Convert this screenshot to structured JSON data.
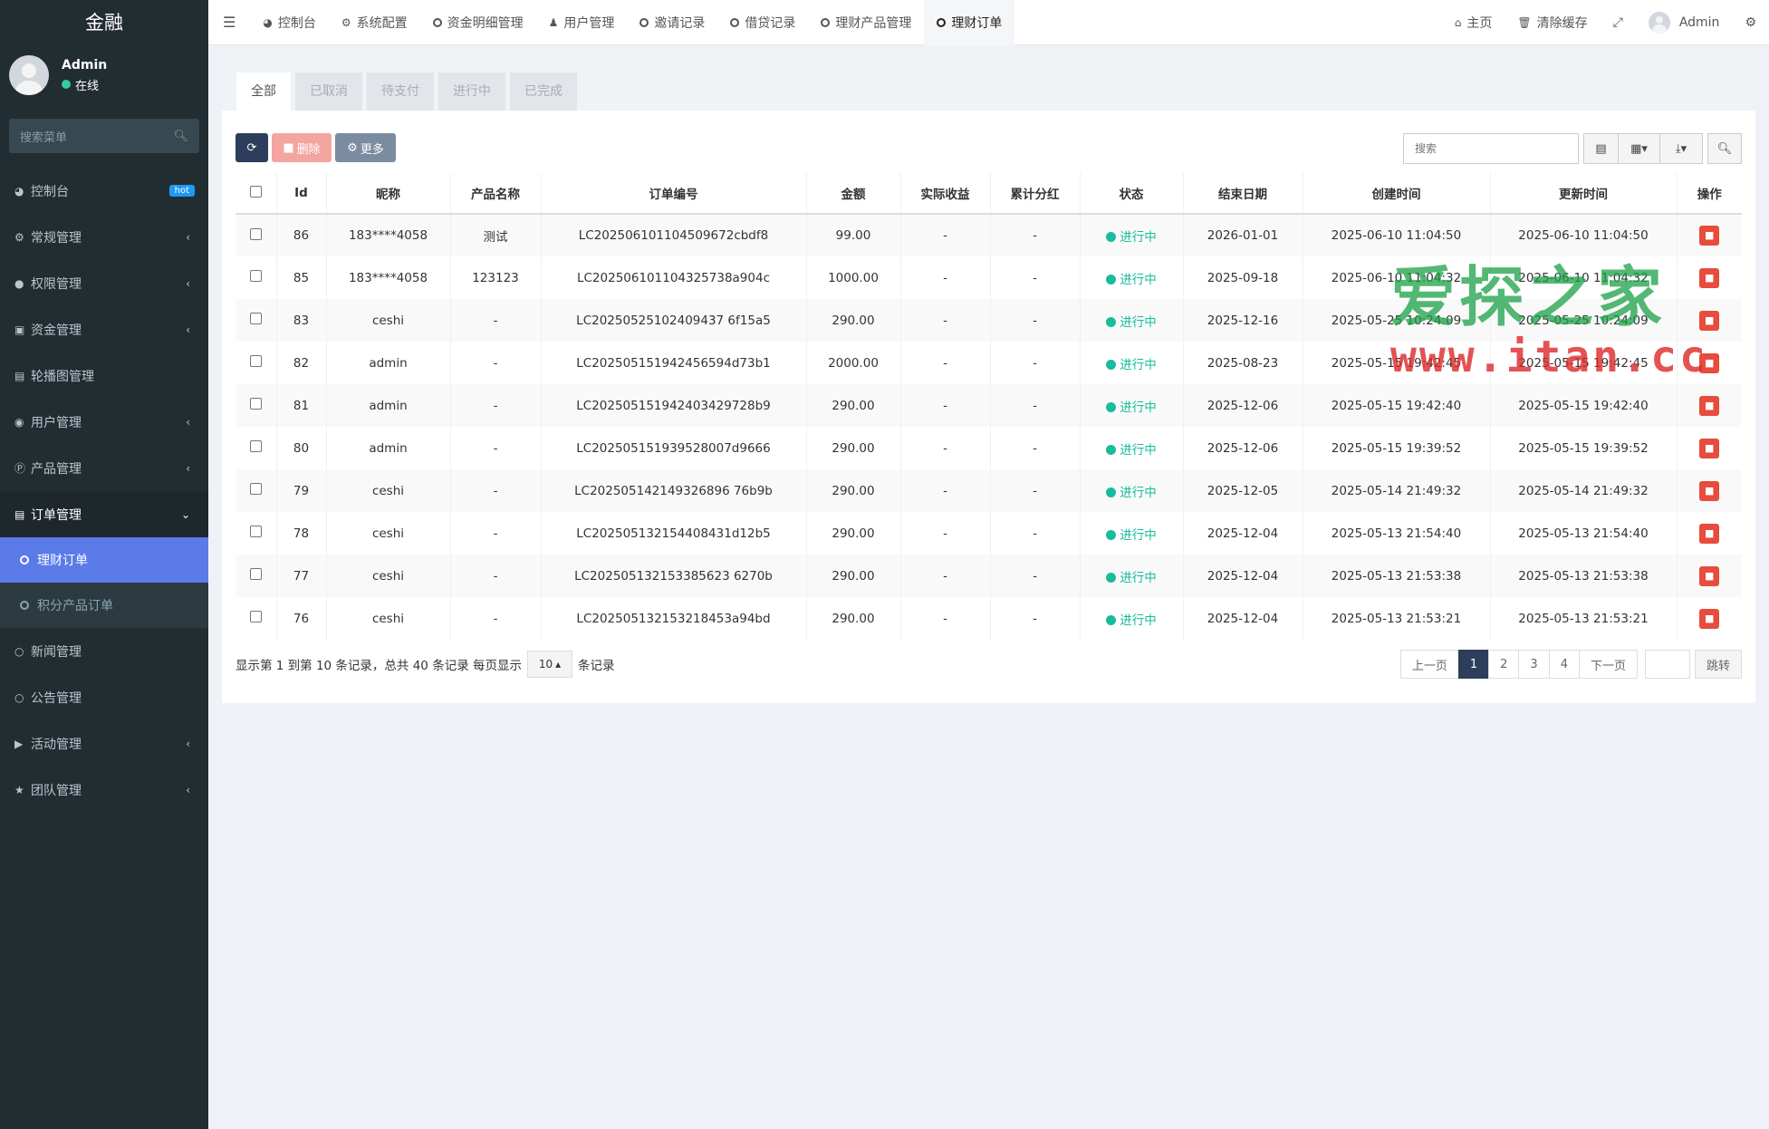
{
  "sidebar": {
    "logo": "金融",
    "user_name": "Admin",
    "user_status": "在线",
    "search_placeholder": "搜索菜单",
    "items": [
      {
        "label": "控制台",
        "icon": "dashboard-icon",
        "badge": "hot"
      },
      {
        "label": "常规管理",
        "icon": "cogs-icon"
      },
      {
        "label": "权限管理",
        "icon": "group-icon"
      },
      {
        "label": "资金管理",
        "icon": "money-icon"
      },
      {
        "label": "轮播图管理",
        "icon": "image-icon"
      },
      {
        "label": "用户管理",
        "icon": "user-circle-icon"
      },
      {
        "label": "产品管理",
        "icon": "product-icon"
      },
      {
        "label": "订单管理",
        "icon": "book-icon"
      },
      {
        "label": "新闻管理",
        "icon": "circle-icon"
      },
      {
        "label": "公告管理",
        "icon": "circle-icon"
      },
      {
        "label": "活动管理",
        "icon": "play-circle-icon"
      },
      {
        "label": "团队管理",
        "icon": "trophy-icon"
      }
    ],
    "sub_items": [
      "理财订单",
      "积分产品订单"
    ]
  },
  "topbar": {
    "tabs": [
      {
        "label": "控制台",
        "icon": "dashboard-icon"
      },
      {
        "label": "系统配置",
        "icon": "cog-icon"
      },
      {
        "label": "资金明细管理",
        "icon": "circle-icon"
      },
      {
        "label": "用户管理",
        "icon": "user-icon"
      },
      {
        "label": "邀请记录",
        "icon": "circle-icon"
      },
      {
        "label": "借贷记录",
        "icon": "circle-icon"
      },
      {
        "label": "理财产品管理",
        "icon": "circle-icon"
      },
      {
        "label": "理财订单",
        "icon": "circle-icon"
      }
    ],
    "home": "主页",
    "clear_cache": "清除缓存",
    "admin": "Admin"
  },
  "panel": {
    "tabs": [
      "全部",
      "已取消",
      "待支付",
      "进行中",
      "已完成"
    ],
    "toolbar": {
      "delete": "删除",
      "more": "更多"
    },
    "search_placeholder": "搜索"
  },
  "table": {
    "headers": [
      "Id",
      "昵称",
      "产品名称",
      "订单编号",
      "金额",
      "实际收益",
      "累计分红",
      "状态",
      "结束日期",
      "创建时间",
      "更新时间",
      "操作"
    ],
    "rows": [
      [
        "86",
        "183****4058",
        "测试",
        "LC202506101104509672cbdf8",
        "99.00",
        "-",
        "-",
        "进行中",
        "2026-01-01",
        "2025-06-10 11:04:50",
        "2025-06-10 11:04:50"
      ],
      [
        "85",
        "183****4058",
        "123123",
        "LC202506101104325738a904c",
        "1000.00",
        "-",
        "-",
        "进行中",
        "2025-09-18",
        "2025-06-10 11:04:32",
        "2025-06-10 11:04:32"
      ],
      [
        "83",
        "ceshi",
        "-",
        "LC20250525102409437 6f15a5",
        "290.00",
        "-",
        "-",
        "进行中",
        "2025-12-16",
        "2025-05-25 10:24:09",
        "2025-05-25 10:24:09"
      ],
      [
        "82",
        "admin",
        "-",
        "LC202505151942456594d73b1",
        "2000.00",
        "-",
        "-",
        "进行中",
        "2025-08-23",
        "2025-05-15 19:42:45",
        "2025-05-15 19:42:45"
      ],
      [
        "81",
        "admin",
        "-",
        "LC202505151942403429728b9",
        "290.00",
        "-",
        "-",
        "进行中",
        "2025-12-06",
        "2025-05-15 19:42:40",
        "2025-05-15 19:42:40"
      ],
      [
        "80",
        "admin",
        "-",
        "LC202505151939528007d9666",
        "290.00",
        "-",
        "-",
        "进行中",
        "2025-12-06",
        "2025-05-15 19:39:52",
        "2025-05-15 19:39:52"
      ],
      [
        "79",
        "ceshi",
        "-",
        "LC202505142149326896 76b9b",
        "290.00",
        "-",
        "-",
        "进行中",
        "2025-12-05",
        "2025-05-14 21:49:32",
        "2025-05-14 21:49:32"
      ],
      [
        "78",
        "ceshi",
        "-",
        "LC202505132154408431d12b5",
        "290.00",
        "-",
        "-",
        "进行中",
        "2025-12-04",
        "2025-05-13 21:54:40",
        "2025-05-13 21:54:40"
      ],
      [
        "77",
        "ceshi",
        "-",
        "LC202505132153385623 6270b",
        "290.00",
        "-",
        "-",
        "进行中",
        "2025-12-04",
        "2025-05-13 21:53:38",
        "2025-05-13 21:53:38"
      ],
      [
        "76",
        "ceshi",
        "-",
        "LC202505132153218453a94bd",
        "290.00",
        "-",
        "-",
        "进行中",
        "2025-12-04",
        "2025-05-13 21:53:21",
        "2025-05-13 21:53:21"
      ]
    ]
  },
  "footer": {
    "summary": "显示第 1 到第 10 条记录，总共 40 条记录 每页显示",
    "page_size": "10",
    "suffix": "条记录",
    "prev": "上一页",
    "pages": [
      "1",
      "2",
      "3",
      "4"
    ],
    "next": "下一页",
    "jump": "跳转"
  },
  "watermark": {
    "line1": "爱探之家",
    "line2": "www.itan.cc"
  },
  "colors": {
    "sidebar_bg": "#222d32",
    "active_blue": "#5b7be9",
    "status_green": "#18bc9c",
    "danger": "#e74c3c"
  }
}
